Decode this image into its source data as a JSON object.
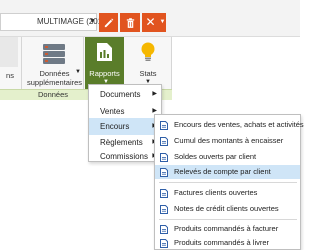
{
  "toolbar": {
    "db_label": "MULTIMAGE (2017)",
    "edit_icon": "pencil-icon",
    "trash_icon": "trash-icon",
    "close_glyph": "✕"
  },
  "ribbon": {
    "groups": [
      {
        "item_fragment": "ns"
      },
      {
        "item_line1": "Données",
        "item_line2": "supplémentaires",
        "group_label": "Données"
      },
      {
        "reports_label": "Rapports",
        "stats_label": "Stats"
      }
    ]
  },
  "menu1": {
    "items": [
      {
        "label": "Documents"
      },
      {
        "label": "Ventes"
      },
      {
        "label": "Encours"
      },
      {
        "label": "Règlements"
      },
      {
        "label": "Commissions"
      }
    ],
    "active_index": 2
  },
  "menu2": {
    "items": [
      "Encours des ventes, achats et activités",
      "Cumul des montants à encaisser",
      "Soldes ouverts par client",
      "Relevés de compte par client",
      "Factures clients ouvertes",
      "Notes de crédit clients ouvertes",
      "Produits commandés à facturer",
      "Produits commandés à livrer"
    ],
    "active_index": 3
  },
  "colors": {
    "accent_orange": "#e1541f",
    "ribbon_green": "#5a7d2a",
    "group_label_bg": "#e4f0cc",
    "menu_highlight": "#cfe5f7"
  }
}
